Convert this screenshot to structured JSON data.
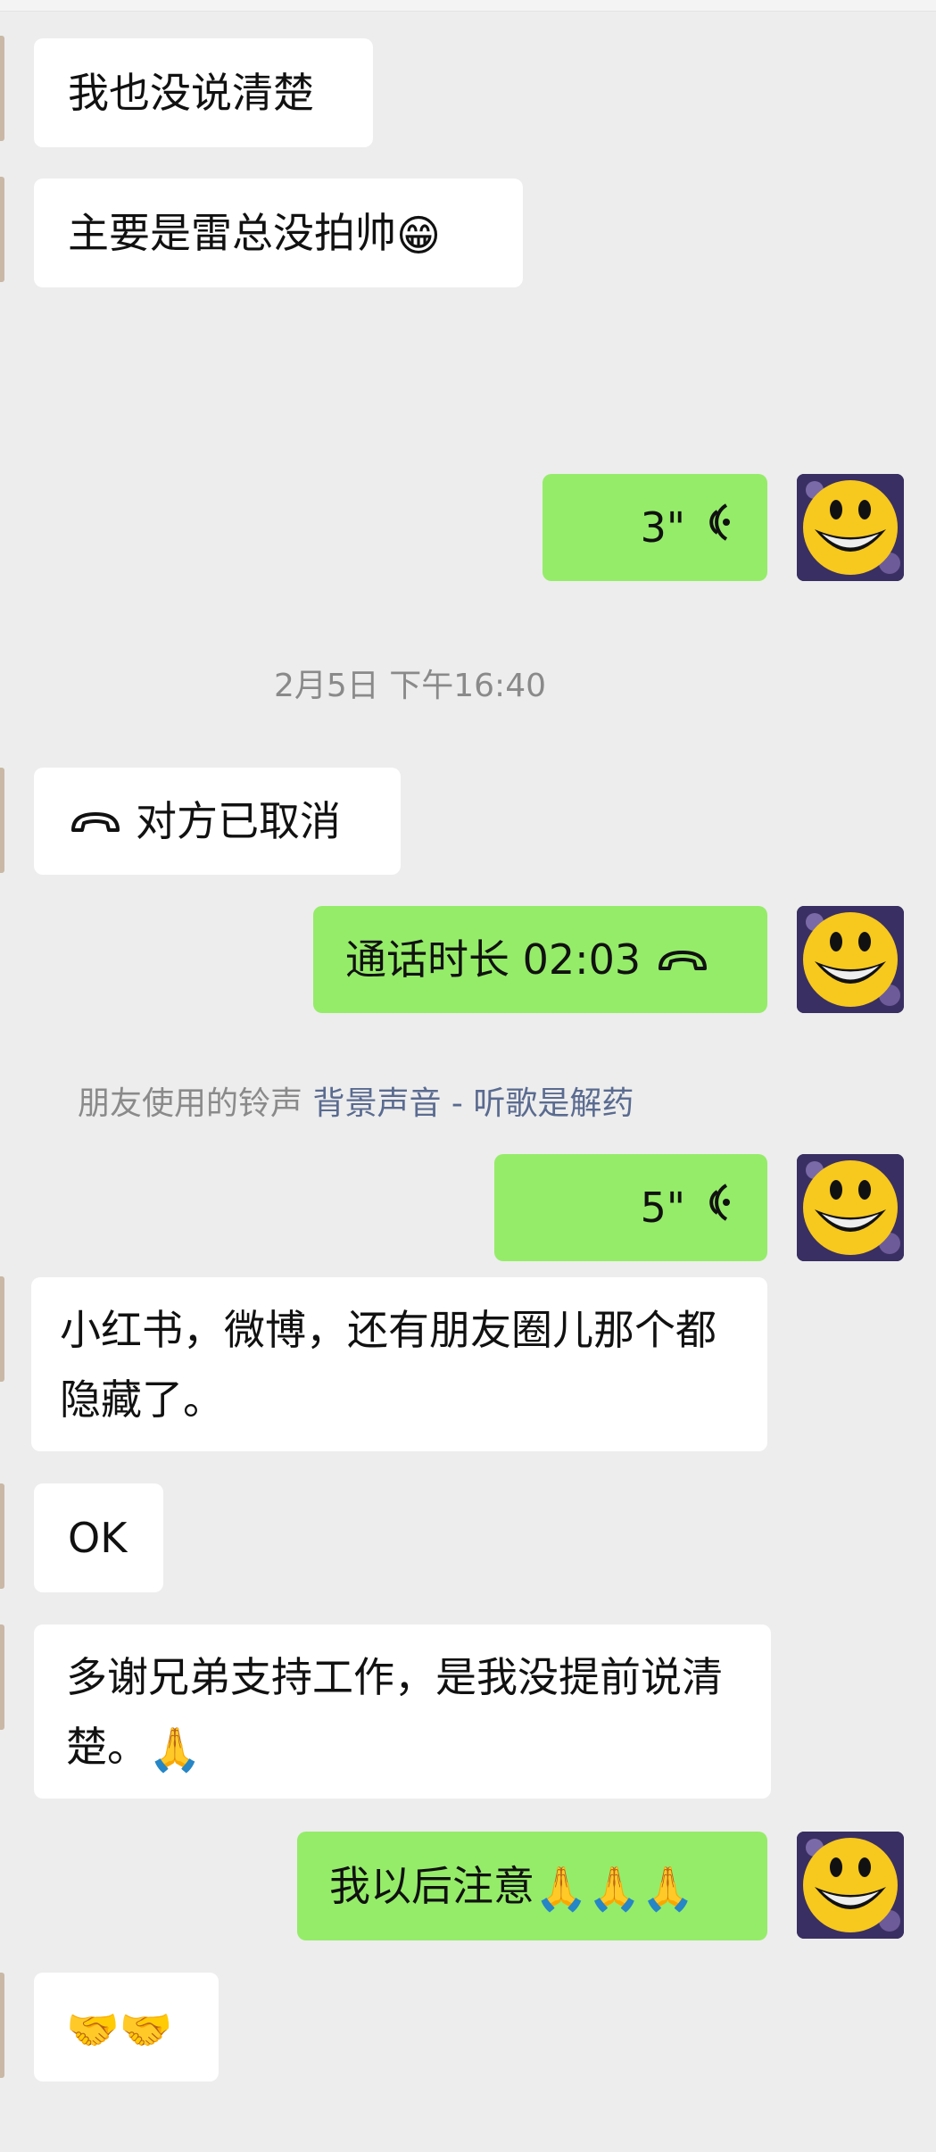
{
  "messages": {
    "m1": "我也没说清楚",
    "m2": "主要是雷总没拍帅",
    "m2_emoji": "😁",
    "voice1_duration": "3\"",
    "timestamp": "2月5日 下午16:40",
    "call_cancelled": "对方已取消",
    "call_duration": "通话时长 02:03",
    "ringtone_prefix": "朋友使用的铃声",
    "ringtone_link": "背景声音 - 听歌是解药",
    "voice2_duration": "5\"",
    "m5": "小红书，微博，还有朋友圈儿那个都隐藏了。",
    "m6": "OK",
    "m7": "多谢兄弟支持工作，是我没提前说清楚。",
    "m7_emoji": "🙏",
    "m8": "我以后注意",
    "m8_emoji": "🙏🙏🙏",
    "m9": "🤝🤝"
  },
  "colors": {
    "background": "#ededed",
    "incoming_bubble": "#ffffff",
    "outgoing_bubble": "#95ec69",
    "link": "#5a6b90",
    "system_text": "#8a8a8a"
  },
  "icons": {
    "avatar": "smiley-face-avatar",
    "voice": "voice-wave-icon",
    "call": "phone-hangup-icon"
  }
}
